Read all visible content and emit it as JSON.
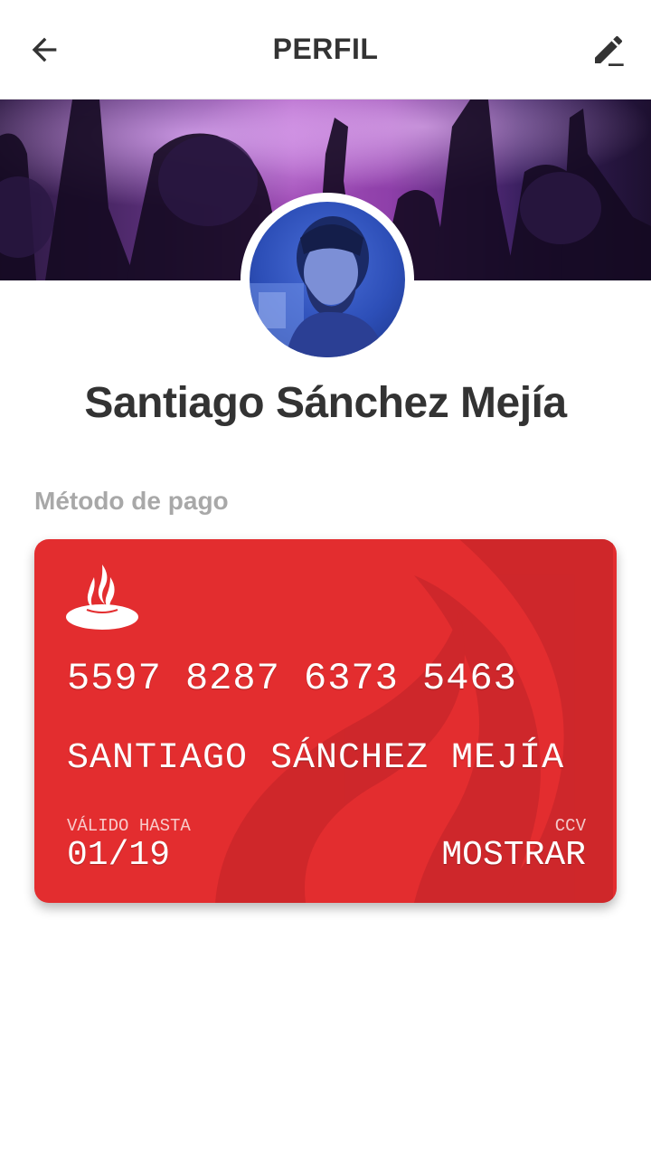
{
  "header": {
    "title": "PERFIL",
    "back_icon": "arrow-left-icon",
    "edit_icon": "pencil-edit-icon"
  },
  "profile": {
    "cover_image": "concert-crowd-photo",
    "avatar_image": "user-photo",
    "name": "Santiago Sánchez Mejía"
  },
  "payment": {
    "section_label": "Método de pago",
    "card": {
      "brand_icon": "santander-flame-icon",
      "color": "#e32d2f",
      "number": "5597 8287 6373 5463",
      "holder": "SANTIAGO SÁNCHEZ MEJÍA",
      "valid_label": "VÁLIDO HASTA",
      "valid_value": "01/19",
      "ccv_label": "CCV",
      "ccv_action": "MOSTRAR"
    }
  }
}
